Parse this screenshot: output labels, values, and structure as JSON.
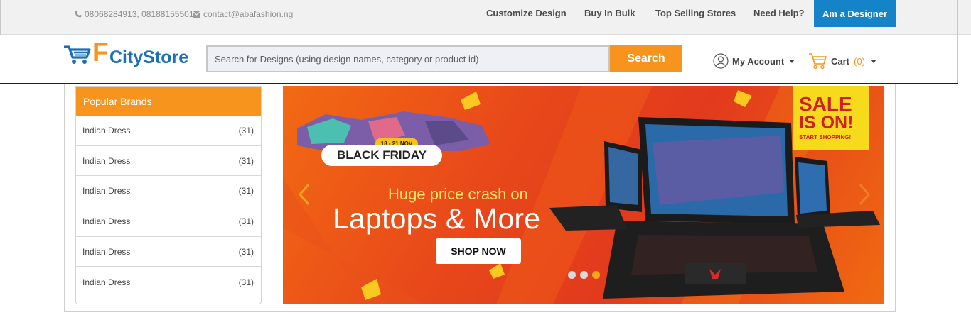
{
  "topbar": {
    "phone": "08068284913, 08188155501",
    "email": "contact@abafashion.ng",
    "nav": [
      "Customize Design",
      "Buy In Bulk",
      "Top Selling Stores",
      "Need Help?"
    ],
    "designer_button": "Am a Designer"
  },
  "header": {
    "logo_letter": "F",
    "logo_text": "CityStore",
    "search_placeholder": "Search for Designs (using design names, category or product id)",
    "search_button": "Search",
    "account_label": "My Account",
    "cart_label": "Cart",
    "cart_count": "(0)"
  },
  "sidebar": {
    "title": "Popular Brands",
    "items": [
      {
        "name": "Indian Dress",
        "count": "(31)"
      },
      {
        "name": "Indian Dress",
        "count": "(31)"
      },
      {
        "name": "Indian Dress",
        "count": "(31)"
      },
      {
        "name": "Indian Dress",
        "count": "(31)"
      },
      {
        "name": "Indian Dress",
        "count": "(31)"
      },
      {
        "name": "Indian Dress",
        "count": "(31)"
      }
    ]
  },
  "banner": {
    "date_tag": "18 - 21 NOV",
    "event": "BLACK FRIDAY",
    "headline": "Huge price crash on",
    "title": "Laptops & More",
    "cta": "SHOP NOW",
    "sale_line1": "SALE",
    "sale_line2": "IS ON!",
    "sale_line3": "START SHOPPING!",
    "slides_total": 3,
    "active_slide": 3
  },
  "colors": {
    "accent": "#f7941d",
    "brand_blue": "#1a6fb8",
    "designer_blue": "#1483c8"
  }
}
